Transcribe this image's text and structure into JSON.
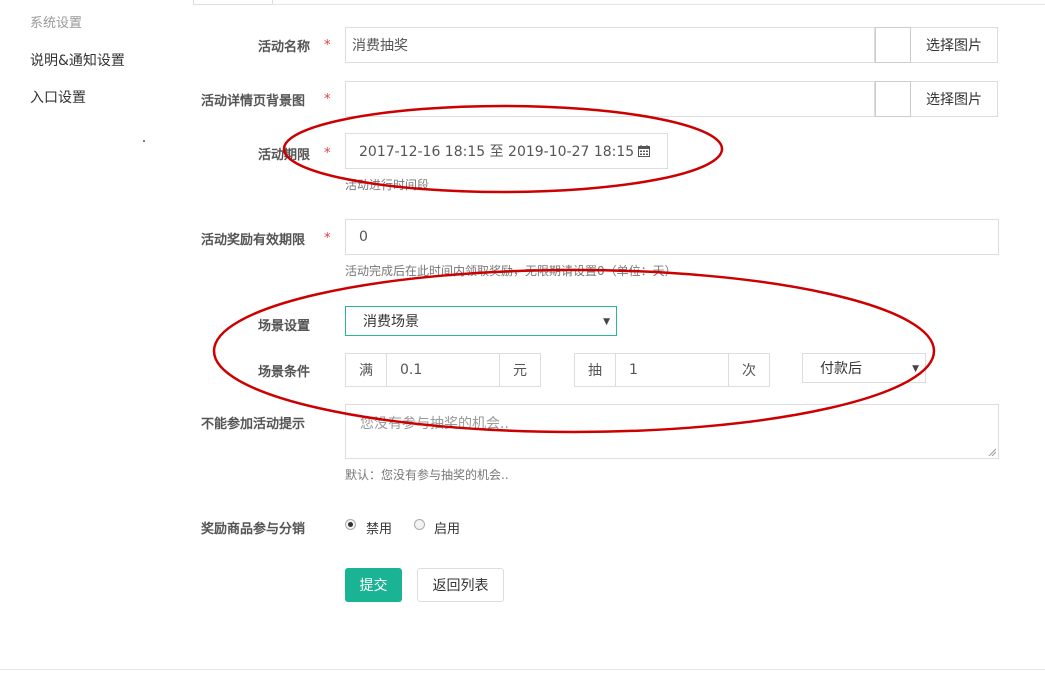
{
  "sidebar": {
    "section": "系统设置",
    "items": [
      {
        "label": "说明&通知设置"
      },
      {
        "label": "入口设置"
      }
    ]
  },
  "form": {
    "required_mark": "*",
    "name": {
      "label": "活动名称",
      "value": "消费抽奖",
      "pic_button": "选择图片"
    },
    "bg": {
      "label": "活动详情页背景图",
      "value": "",
      "pic_button": "选择图片"
    },
    "period": {
      "label": "活动期限",
      "value": "2017-12-16 18:15 至 2019-10-27 18:15",
      "help": "活动进行时间段",
      "icon": "calendar-icon"
    },
    "reward_period": {
      "label": "活动奖励有效期限",
      "value": "0",
      "help": "活动完成后在此时间内领取奖励，无限期请设置0（单位：天）"
    },
    "scene": {
      "label": "场景设置",
      "selected": "消费场景"
    },
    "condition": {
      "label": "场景条件",
      "prefix": "满",
      "amount": "0.1",
      "unit": "元",
      "draw_prefix": "抽",
      "draw_count": "1",
      "draw_unit": "次",
      "timing": "付款后"
    },
    "cannot_join": {
      "label": "不能参加活动提示",
      "value": "您没有参与抽奖的机会..",
      "help": "默认：您没有参与抽奖的机会.."
    },
    "distribution": {
      "label": "奖励商品参与分销",
      "options": [
        {
          "label": "禁用",
          "checked": true
        },
        {
          "label": "启用",
          "checked": false
        }
      ]
    }
  },
  "actions": {
    "submit": "提交",
    "back": "返回列表"
  },
  "colors": {
    "primary": "#1ab394",
    "required": "#e4393c",
    "annotation": "#cc0000",
    "select_border": "#29b894"
  }
}
